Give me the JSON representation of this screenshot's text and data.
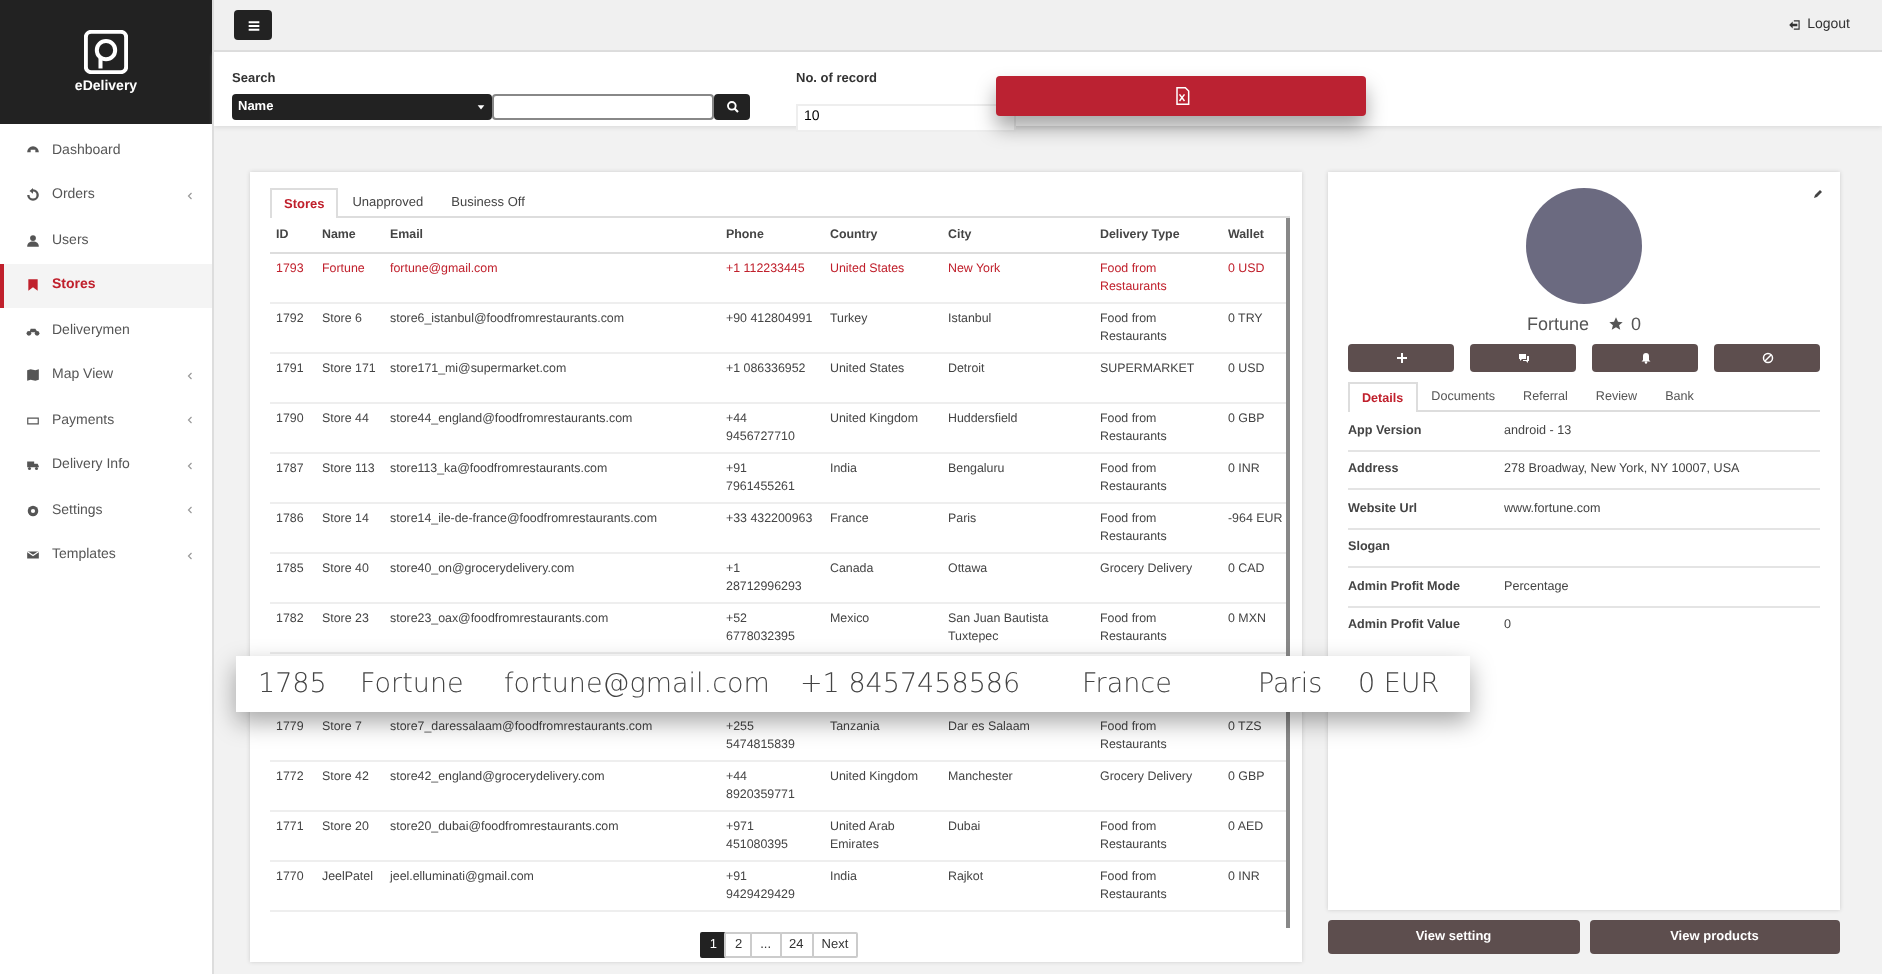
{
  "sidebar": {
    "logo_text": "eDelivery",
    "items": [
      {
        "label": "Dashboard",
        "kind": "dashboard",
        "submenu": false,
        "selected": false
      },
      {
        "label": "Orders",
        "kind": "orders",
        "submenu": true,
        "selected": false
      },
      {
        "label": "Users",
        "kind": "user",
        "submenu": false,
        "selected": false
      },
      {
        "label": "Stores",
        "kind": "store",
        "submenu": false,
        "selected": true
      },
      {
        "label": "Deliverymen",
        "kind": "bike",
        "submenu": false,
        "selected": false
      },
      {
        "label": "Map View",
        "kind": "map",
        "submenu": true,
        "selected": false
      },
      {
        "label": "Payments",
        "kind": "card",
        "submenu": true,
        "selected": false
      },
      {
        "label": "Delivery Info",
        "kind": "truck",
        "submenu": true,
        "selected": false
      },
      {
        "label": "Settings",
        "kind": "gear",
        "submenu": true,
        "selected": false
      },
      {
        "label": "Templates",
        "kind": "mail",
        "submenu": true,
        "selected": false
      }
    ]
  },
  "topbar": {
    "logout": "Logout"
  },
  "filters": {
    "search_label": "Search",
    "search_by": "Name",
    "records_label": "No. of record",
    "records": "10"
  },
  "tabs": [
    {
      "label": "Stores",
      "selected": true
    },
    {
      "label": "Unapproved",
      "selected": false
    },
    {
      "label": "Business Off",
      "selected": false
    }
  ],
  "table": {
    "columns": [
      "ID",
      "Name",
      "Email",
      "Phone",
      "Country",
      "City",
      "Delivery Type",
      "Wallet"
    ],
    "rows": [
      {
        "selected": true,
        "cells": [
          "1793",
          "Fortune",
          "fortune@gmail.com",
          "+1 112233445",
          "United States",
          "New York",
          "Food from Restaurants",
          "0 USD"
        ]
      },
      {
        "selected": false,
        "cells": [
          "1792",
          "Store 6",
          "store6_istanbul@foodfromrestaurants.com",
          "+90 412804991",
          "Turkey",
          "Istanbul",
          "Food from Restaurants",
          "0 TRY"
        ]
      },
      {
        "selected": false,
        "cells": [
          "1791",
          "Store 171",
          "store171_mi@supermarket.com",
          "+1 086336952",
          "United States",
          "Detroit",
          "SUPERMARKET",
          "0 USD"
        ]
      },
      {
        "selected": false,
        "cells": [
          "1790",
          "Store 44",
          "store44_england@foodfromrestaurants.com",
          "+44 9456727710",
          "United Kingdom",
          "Huddersfield",
          "Food from Restaurants",
          "0 GBP"
        ]
      },
      {
        "selected": false,
        "cells": [
          "1787",
          "Store 113",
          "store113_ka@foodfromrestaurants.com",
          "+91 7961455261",
          "India",
          "Bengaluru",
          "Food from Restaurants",
          "0 INR"
        ]
      },
      {
        "selected": false,
        "cells": [
          "1786",
          "Store 14",
          "store14_ile-de-france@foodfromrestaurants.com",
          "+33 432200963",
          "France",
          "Paris",
          "Food from Restaurants",
          "-964 EUR"
        ]
      },
      {
        "selected": false,
        "cells": [
          "1785",
          "Store 40",
          "store40_on@grocerydelivery.com",
          "+1 28712996293",
          "Canada",
          "Ottawa",
          "Grocery Delivery",
          "0 CAD"
        ]
      },
      {
        "selected": false,
        "cells": [
          "1782",
          "Store 23",
          "store23_oax@foodfromrestaurants.com",
          "+52 6778032395",
          "Mexico",
          "San Juan Bautista Tuxtepec",
          "Food from Restaurants",
          "0 MXN"
        ]
      },
      {
        "selected": false,
        "hidden_gap": true,
        "cells": [
          "1779",
          "Store 7",
          "store7_daressalaam@foodfromrestaurants.com",
          "+255 5474815839",
          "Tanzania",
          "Dar es Salaam",
          "Food from Restaurants",
          "0 TZS"
        ]
      },
      {
        "selected": false,
        "cells": [
          "1772",
          "Store 42",
          "store42_england@grocerydelivery.com",
          "+44 8920359771",
          "United Kingdom",
          "Manchester",
          "Grocery Delivery",
          "0 GBP"
        ]
      },
      {
        "selected": false,
        "cells": [
          "1771",
          "Store 20",
          "store20_dubai@foodfromrestaurants.com",
          "+971 451080395",
          "United Arab Emirates",
          "Dubai",
          "Food from Restaurants",
          "0 AED"
        ]
      },
      {
        "selected": false,
        "cells": [
          "1770",
          "JeelPatel",
          "jeel.elluminati@gmail.com",
          "+91 9429429429",
          "India",
          "Rajkot",
          "Food from Restaurants",
          "0 INR"
        ]
      }
    ]
  },
  "pagination": [
    {
      "label": "1",
      "selected": true
    },
    {
      "label": "2",
      "selected": false
    },
    {
      "label": "...",
      "selected": false
    },
    {
      "label": "24",
      "selected": false
    },
    {
      "label": "Next",
      "selected": false
    }
  ],
  "highlight_row": [
    "1785",
    "Fortune",
    "fortune@gmail.com",
    "+1 8457458586",
    "France",
    "Paris",
    "0 EUR"
  ],
  "detail": {
    "name": "Fortune",
    "rating": "0",
    "actions": [
      {
        "kind": "add"
      },
      {
        "kind": "chat"
      },
      {
        "kind": "bell"
      },
      {
        "kind": "block"
      }
    ],
    "tabs": [
      {
        "label": "Details",
        "selected": true
      },
      {
        "label": "Documents",
        "selected": false
      },
      {
        "label": "Referral",
        "selected": false
      },
      {
        "label": "Review",
        "selected": false
      },
      {
        "label": "Bank",
        "selected": false
      }
    ],
    "fields": [
      {
        "label": "App Version",
        "value": "android - 13"
      },
      {
        "label": "Address",
        "value": "278 Broadway, New York, NY 10007, USA"
      },
      {
        "label": "Website Url",
        "value": "www.fortune.com"
      },
      {
        "label": "Slogan"
      },
      {
        "label": "Admin Profit Mode",
        "value": "Percentage"
      },
      {
        "label": "Admin Profit Value",
        "value": "0"
      }
    ],
    "buttons": [
      "View setting",
      "View products"
    ]
  }
}
